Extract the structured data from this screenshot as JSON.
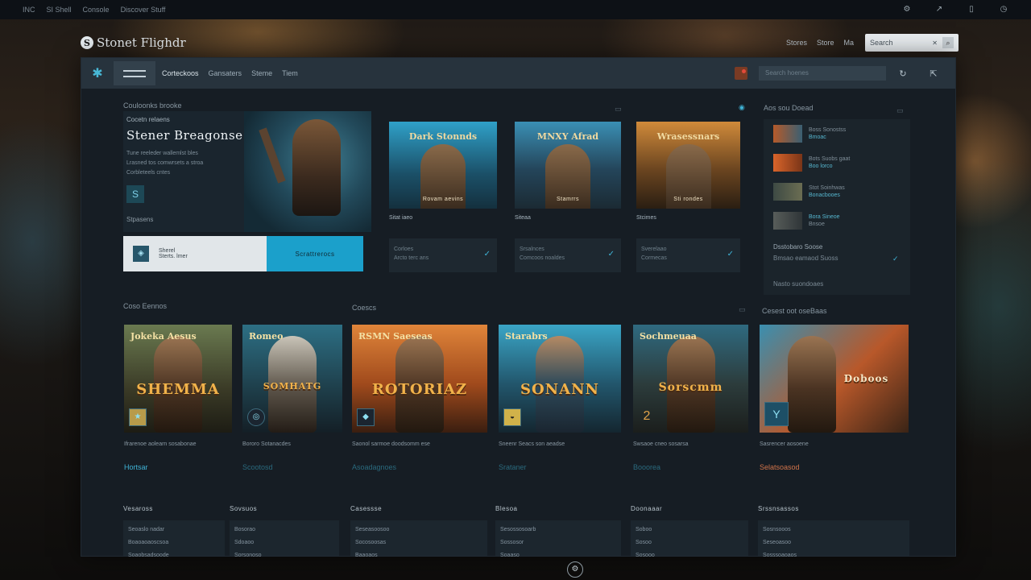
{
  "os_bar": {
    "items": [
      "INC",
      "SI Shell",
      "Console",
      "Discover Stuff"
    ]
  },
  "header": {
    "app_name": "Stonet Flighdr",
    "links": [
      "Stores",
      "Store",
      "Ma"
    ],
    "search_placeholder": "Search"
  },
  "nav": {
    "tabs": [
      "Corteckoos",
      "Gansaters",
      "Steme",
      "Tiem"
    ],
    "search_placeholder": "Search hoenes"
  },
  "featured": {
    "section_label": "Couloonks brooke",
    "kicker": "Cocetn relaens",
    "title": "Stener Breagonse",
    "desc": [
      "Tune reeleder wallemlst bles",
      "Lrasned tos comwrsets a stroa",
      "Corbleteels cntes"
    ],
    "tag": "Stpasens",
    "bar_title": "Sherel",
    "bar_sub": "Sterts. lmer",
    "cta": "Scrattrerocs"
  },
  "top_cards": [
    {
      "banner": "Dark Stonnds",
      "caption": "Rovam aevins",
      "name": "Sitat iaeo",
      "info1": "Corloes",
      "info2": "Arcto terc ans"
    },
    {
      "banner": "MNXY Afrad",
      "caption": "Stamrrs",
      "name": "Siteaa",
      "info1": "Srsalnces",
      "info2": "Comcoos noaldes"
    },
    {
      "banner": "Wrasessnars",
      "caption": "Sti rondes",
      "name": "Stcimes",
      "info1": "Sverelaao",
      "info2": "Cormecas"
    }
  ],
  "right_panel": {
    "label": "Aos sou Doead",
    "items": [
      {
        "l1": "Boss Sonostss",
        "l2": "Bmoac"
      },
      {
        "l1": "Bots Suobs gaat",
        "l2": "Boo lorco"
      },
      {
        "l1": "Stot Soinhwas",
        "l2": "Bonacbooes"
      },
      {
        "l1": "Bora Sineoe",
        "l2": "Bnsoe"
      }
    ],
    "foot1": "Dsstobaro Soose",
    "foot2": "Bmsao eamaod Suoss",
    "foot3": "Nasto suondoaes"
  },
  "row2": {
    "label_left": "Coso Eennos",
    "label_mid": "Coescs",
    "label_right": "Cesest oot oseBaas",
    "cards": [
      {
        "top": "Jokeka Aesus",
        "title": "SHEMMA",
        "meta1": "Ifrarenoe aolearn sosabonae",
        "meta2": "Hortsar"
      },
      {
        "top": "Romeo",
        "title": "SOMHATG",
        "meta1": "Bororo Sotanacdes",
        "meta2": "Scootosd"
      },
      {
        "top": "RSMN Saeseas",
        "title": "ROTORIAZ",
        "meta1": "Saonol sarmoe doodsomm ese",
        "meta2": "Asoadagnoes"
      },
      {
        "top": "Starabrs",
        "title": "SONANN",
        "meta1": "Sneenr Seacs son aeadse",
        "meta2": "Srataner"
      },
      {
        "top": "Sochmeuaa",
        "title": "Sorscmm",
        "meta1": "Swsaoe cneo sosarsa",
        "meta2": "Booorea"
      },
      {
        "top": "",
        "title": "Doboos",
        "meta1": "Sasrencer aosoene",
        "meta2": "Selatsoasod"
      }
    ]
  },
  "footer": {
    "cols": [
      {
        "h": "Vesaross",
        "a": "Seoaslo nadar",
        "b": "Boaoaoaoscsoa",
        "c": "Soaobsadsoode"
      },
      {
        "h": "Sovsuos",
        "a": "Bosorao",
        "b": "Sdoaoo",
        "c": "Sorsonoso"
      },
      {
        "h": "Casessse",
        "a": "Seseasoosoo",
        "b": "Socosoosas",
        "c": "Baaoaos"
      },
      {
        "h": "Blesoa",
        "a": "Sesossosoarb",
        "b": "Sossosor",
        "c": "Soaaso"
      },
      {
        "h": "Doonaaar",
        "a": "Soboo",
        "b": "Sosoo",
        "c": "Sosooo"
      },
      {
        "h": "Srssnsassos",
        "a": "Sosnsooos",
        "b": "Seseoasoo",
        "c": "Sosssoaoaos"
      }
    ]
  },
  "colors": {
    "accent": "#1ba0cb",
    "panel": "#161d24",
    "nav": "#27333d"
  }
}
